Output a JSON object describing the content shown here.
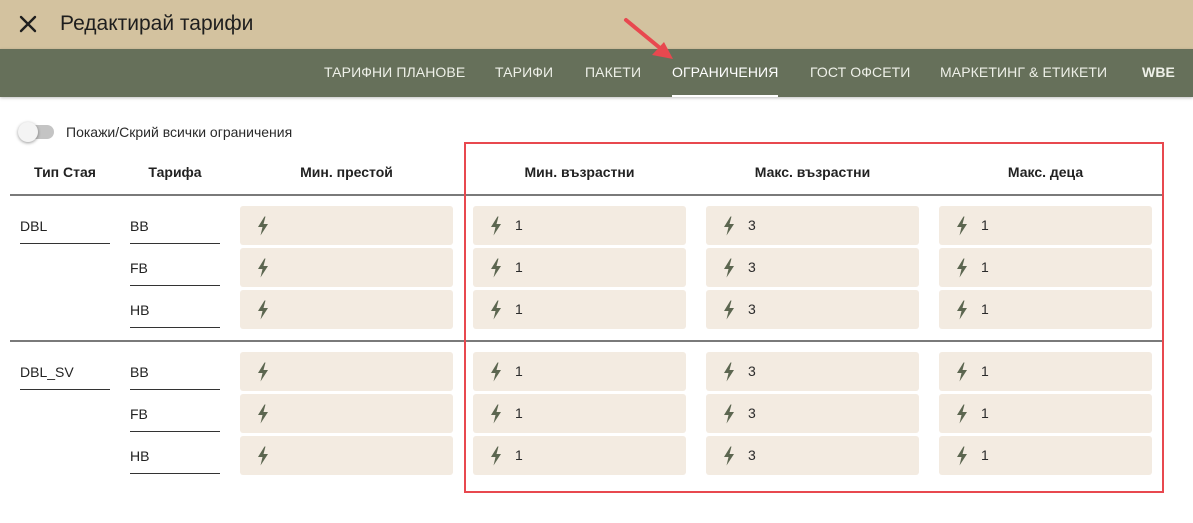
{
  "header": {
    "title": "Редактирай тарифи",
    "close_icon": "close-icon"
  },
  "tabs": [
    {
      "label": "ТАРИФНИ ПЛАНОВЕ",
      "active": false
    },
    {
      "label": "ТАРИФИ",
      "active": false
    },
    {
      "label": "ПАКЕТИ",
      "active": false
    },
    {
      "label": "ОГРАНИЧЕНИЯ",
      "active": true
    },
    {
      "label": "ГОСТ ОФСЕТИ",
      "active": false
    },
    {
      "label": "МАРКЕТИНГ & ЕТИКЕТИ",
      "active": false
    },
    {
      "label": "WBE",
      "active": false
    }
  ],
  "toggle": {
    "label": "Покажи/Скрий всички ограничения",
    "checked": false
  },
  "columns": {
    "room_type": "Тип Стая",
    "rate": "Тарифа",
    "min_stay": "Мин. престой",
    "min_adults": "Мин. възрастни",
    "max_adults": "Макс. възрастни",
    "max_children": "Макс. деца"
  },
  "groups": [
    {
      "room": "DBL",
      "rows": [
        {
          "rate": "BB",
          "min_stay": "",
          "min_adults": "1",
          "max_adults": "3",
          "max_children": "1"
        },
        {
          "rate": "FB",
          "min_stay": "",
          "min_adults": "1",
          "max_adults": "3",
          "max_children": "1"
        },
        {
          "rate": "HB",
          "min_stay": "",
          "min_adults": "1",
          "max_adults": "3",
          "max_children": "1"
        }
      ]
    },
    {
      "room": "DBL_SV",
      "rows": [
        {
          "rate": "BB",
          "min_stay": "",
          "min_adults": "1",
          "max_adults": "3",
          "max_children": "1"
        },
        {
          "rate": "FB",
          "min_stay": "",
          "min_adults": "1",
          "max_adults": "3",
          "max_children": "1"
        },
        {
          "rate": "HB",
          "min_stay": "",
          "min_adults": "1",
          "max_adults": "3",
          "max_children": "1"
        }
      ]
    }
  ],
  "colors": {
    "titlebar_bg": "#d3c29f",
    "navbar_bg": "#66705a",
    "cell_bg": "#f3ebe1",
    "bolt": "#5c6650",
    "annotation": "#e8484f"
  },
  "icons": {
    "cell_icon": "lightning-bolt-icon",
    "annotation_arrow": "arrow-icon"
  }
}
